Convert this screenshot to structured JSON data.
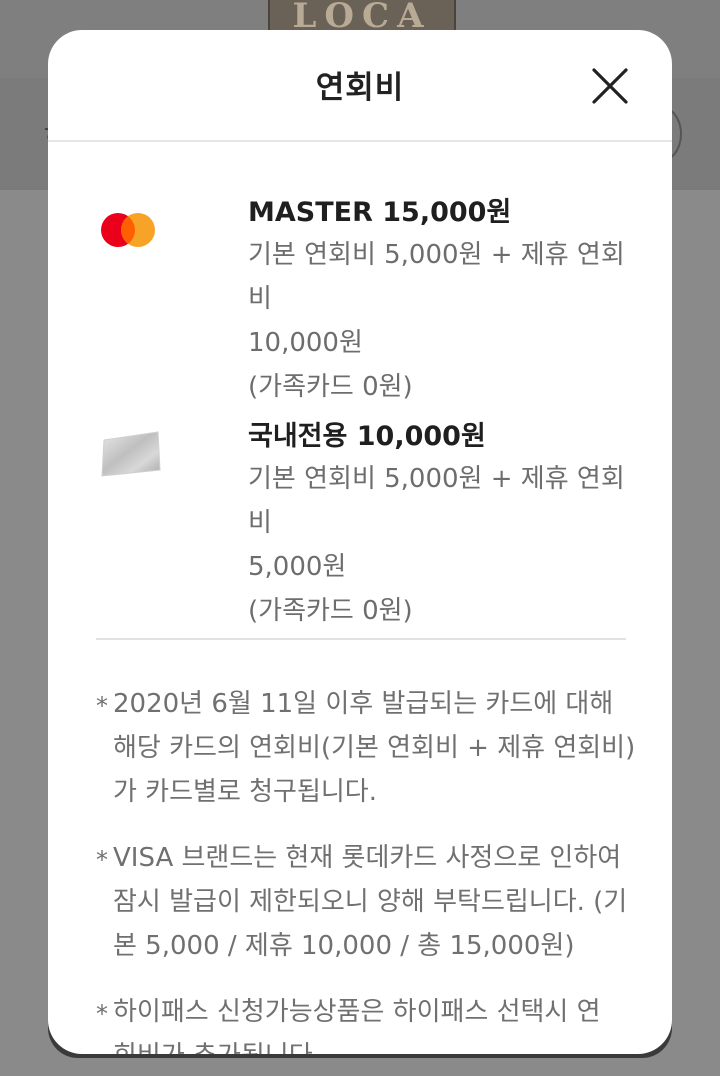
{
  "background": {
    "logo_text": "LOCA"
  },
  "modal": {
    "title": "연회비",
    "close_icon": "close-icon"
  },
  "cards": [
    {
      "icon": "mastercard-logo-icon",
      "title": "MASTER 15,000원",
      "desc_lines": [
        "기본 연회비 5,000원 + 제휴 연회비",
        "10,000원",
        "(가족카드 0원)"
      ]
    },
    {
      "icon": "domestic-card-icon",
      "title": "국내전용 10,000원",
      "desc_lines": [
        "기본 연회비 5,000원 + 제휴 연회비",
        "5,000원",
        "(가족카드 0원)"
      ]
    }
  ],
  "notes": [
    {
      "marker": "*",
      "lines": [
        "2020년 6월 11일 이후 발급되는 카드에 대해",
        "해당 카드의 연회비(기본 연회비 + 제휴 연회비)",
        "가 카드별로 청구됩니다."
      ]
    },
    {
      "marker": "*",
      "lines": [
        "VISA 브랜드는 현재 롯데카드 사정으로 인하여",
        "잠시 발급이 제한되오니 양해 부탁드립니다. (기",
        "본 5,000 / 제휴 10,000 / 총 15,000원)"
      ]
    },
    {
      "marker": "*",
      "lines": [
        "하이패스 신청가능상품은 하이패스 선택시 연",
        "회비가 추가됩니다."
      ]
    }
  ],
  "colors": {
    "mastercard_red": "#eb001b",
    "mastercard_orange": "#f79e1b",
    "overlay": "#8a8a8a"
  }
}
